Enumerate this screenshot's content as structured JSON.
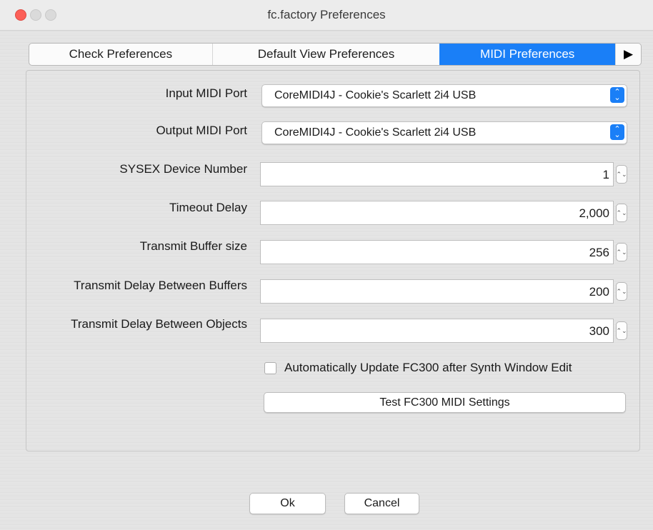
{
  "window": {
    "title": "fc.factory Preferences"
  },
  "tabs": [
    {
      "label": "Check Preferences"
    },
    {
      "label": "Default View Preferences"
    },
    {
      "label": "MIDI Preferences",
      "selected": true
    }
  ],
  "tab_scroll_arrow": "▶",
  "form": {
    "input_midi_port": {
      "label": "Input MIDI Port",
      "value": "CoreMIDI4J - Cookie's Scarlett 2i4 USB"
    },
    "output_midi_port": {
      "label": "Output MIDI Port",
      "value": "CoreMIDI4J - Cookie's Scarlett 2i4 USB"
    },
    "sysex_device_number": {
      "label": "SYSEX Device Number",
      "value": "1"
    },
    "timeout_delay": {
      "label": "Timeout Delay",
      "value": "2,000"
    },
    "transmit_buffer_size": {
      "label": "Transmit Buffer size",
      "value": "256"
    },
    "transmit_delay_between_buffers": {
      "label": "Transmit Delay Between Buffers",
      "value": "200"
    },
    "transmit_delay_between_objects": {
      "label": "Transmit Delay Between Objects",
      "value": "300"
    },
    "auto_update_checkbox": {
      "label": "Automatically Update FC300 after Synth Window Edit",
      "checked": false
    },
    "test_button": "Test FC300 MIDI Settings"
  },
  "footer": {
    "ok": "Ok",
    "cancel": "Cancel"
  },
  "colors": {
    "accent": "#1a7ff7",
    "close": "#fc5f57"
  }
}
